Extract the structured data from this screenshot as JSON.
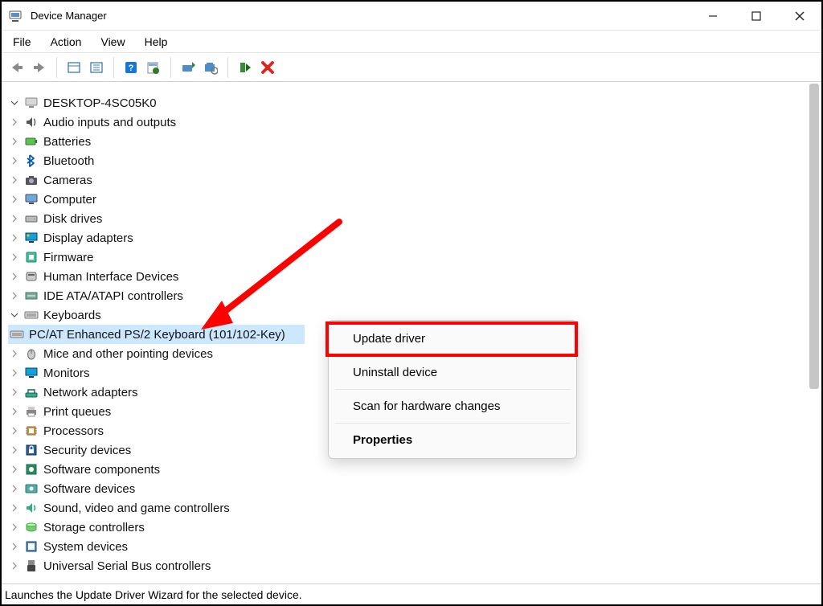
{
  "window": {
    "title": "Device Manager"
  },
  "menu": {
    "file": "File",
    "action": "Action",
    "view": "View",
    "help": "Help"
  },
  "tree": {
    "root": "DESKTOP-4SC05K0",
    "items": [
      {
        "label": "Audio inputs and outputs",
        "icon": "audio"
      },
      {
        "label": "Batteries",
        "icon": "battery"
      },
      {
        "label": "Bluetooth",
        "icon": "bluetooth"
      },
      {
        "label": "Cameras",
        "icon": "camera"
      },
      {
        "label": "Computer",
        "icon": "computer"
      },
      {
        "label": "Disk drives",
        "icon": "disk"
      },
      {
        "label": "Display adapters",
        "icon": "display"
      },
      {
        "label": "Firmware",
        "icon": "firmware"
      },
      {
        "label": "Human Interface Devices",
        "icon": "hid"
      },
      {
        "label": "IDE ATA/ATAPI controllers",
        "icon": "ide"
      },
      {
        "label": "Keyboards",
        "icon": "keyboard",
        "expanded": true,
        "children": [
          {
            "label": "PC/AT Enhanced PS/2 Keyboard (101/102-Key)",
            "icon": "keyboard",
            "selected": true
          }
        ]
      },
      {
        "label": "Mice and other pointing devices",
        "icon": "mouse"
      },
      {
        "label": "Monitors",
        "icon": "monitor"
      },
      {
        "label": "Network adapters",
        "icon": "network"
      },
      {
        "label": "Print queues",
        "icon": "printer"
      },
      {
        "label": "Processors",
        "icon": "cpu"
      },
      {
        "label": "Security devices",
        "icon": "security"
      },
      {
        "label": "Software components",
        "icon": "swc"
      },
      {
        "label": "Software devices",
        "icon": "swd"
      },
      {
        "label": "Sound, video and game controllers",
        "icon": "sound"
      },
      {
        "label": "Storage controllers",
        "icon": "storage"
      },
      {
        "label": "System devices",
        "icon": "system"
      },
      {
        "label": "Universal Serial Bus controllers",
        "icon": "usb"
      }
    ]
  },
  "context_menu": {
    "update": "Update driver",
    "uninstall": "Uninstall device",
    "scan": "Scan for hardware changes",
    "properties": "Properties"
  },
  "status": "Launches the Update Driver Wizard for the selected device."
}
